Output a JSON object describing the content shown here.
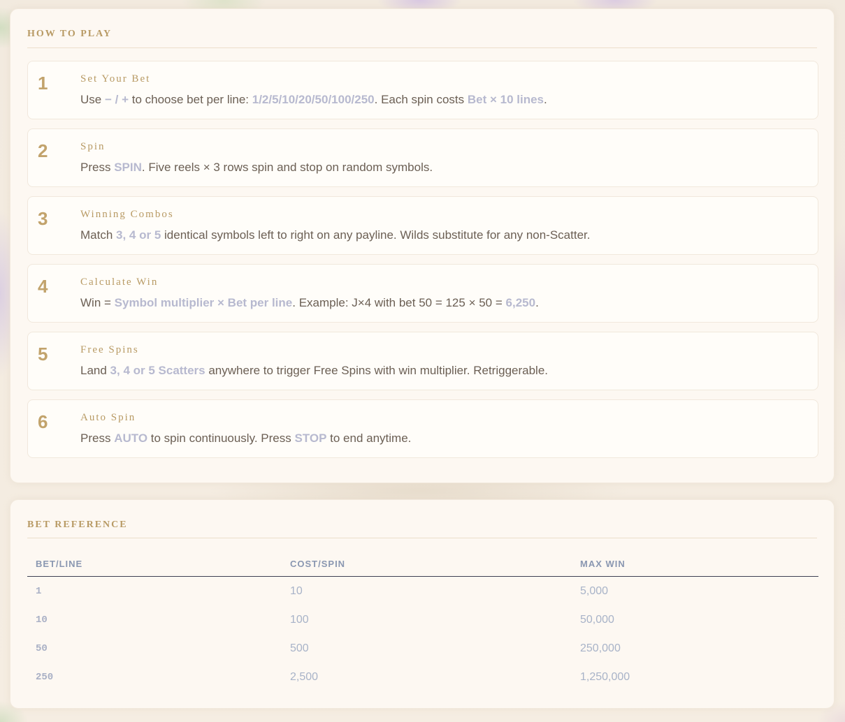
{
  "how_to_play": {
    "title": "HOW TO PLAY",
    "steps": [
      {
        "number": "1",
        "title": "Set Your Bet",
        "desc": [
          {
            "t": "Use ",
            "hl": false
          },
          {
            "t": "− / +",
            "hl": true
          },
          {
            "t": " to choose bet per line: ",
            "hl": false
          },
          {
            "t": "1/2/5/10/20/50/100/250",
            "hl": true
          },
          {
            "t": ". Each spin costs ",
            "hl": false
          },
          {
            "t": "Bet × 10 lines",
            "hl": true
          },
          {
            "t": ".",
            "hl": false
          }
        ]
      },
      {
        "number": "2",
        "title": "Spin",
        "desc": [
          {
            "t": "Press ",
            "hl": false
          },
          {
            "t": "SPIN",
            "hl": true
          },
          {
            "t": ". Five reels × 3 rows spin and stop on random symbols.",
            "hl": false
          }
        ]
      },
      {
        "number": "3",
        "title": "Winning Combos",
        "desc": [
          {
            "t": "Match ",
            "hl": false
          },
          {
            "t": "3, 4 or 5",
            "hl": true
          },
          {
            "t": " identical symbols left to right on any payline. Wilds substitute for any non-Scatter.",
            "hl": false
          }
        ]
      },
      {
        "number": "4",
        "title": "Calculate Win",
        "desc": [
          {
            "t": "Win = ",
            "hl": false
          },
          {
            "t": "Symbol multiplier × Bet per line",
            "hl": true
          },
          {
            "t": ". Example: J×4 with bet 50 = 125 × 50 = ",
            "hl": false
          },
          {
            "t": "6,250",
            "hl": true
          },
          {
            "t": ".",
            "hl": false
          }
        ]
      },
      {
        "number": "5",
        "title": "Free Spins",
        "desc": [
          {
            "t": "Land ",
            "hl": false
          },
          {
            "t": "3, 4 or 5 Scatters",
            "hl": true
          },
          {
            "t": " anywhere to trigger Free Spins with win multiplier. Retriggerable.",
            "hl": false
          }
        ]
      },
      {
        "number": "6",
        "title": "Auto Spin",
        "desc": [
          {
            "t": "Press ",
            "hl": false
          },
          {
            "t": "AUTO",
            "hl": true
          },
          {
            "t": " to spin continuously. Press ",
            "hl": false
          },
          {
            "t": "STOP",
            "hl": true
          },
          {
            "t": " to end anytime.",
            "hl": false
          }
        ]
      }
    ]
  },
  "bet_reference": {
    "title": "BET REFERENCE",
    "columns": [
      "BET/LINE",
      "COST/SPIN",
      "MAX WIN"
    ],
    "rows": [
      [
        "1",
        "10",
        "5,000"
      ],
      [
        "10",
        "100",
        "50,000"
      ],
      [
        "50",
        "500",
        "250,000"
      ],
      [
        "250",
        "2,500",
        "1,250,000"
      ]
    ]
  }
}
